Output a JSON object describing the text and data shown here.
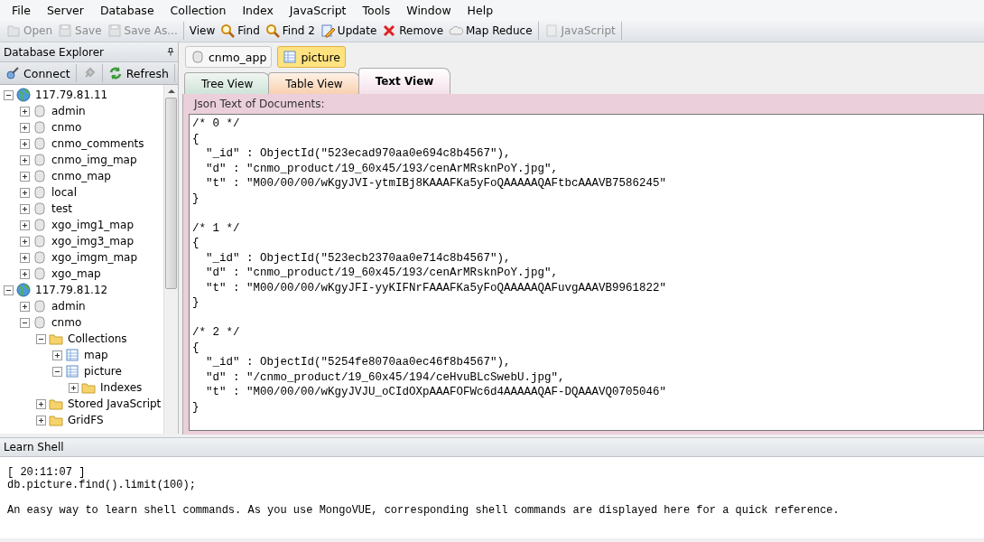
{
  "menu": [
    "File",
    "Server",
    "Database",
    "Collection",
    "Index",
    "JavaScript",
    "Tools",
    "Window",
    "Help"
  ],
  "toolbar": [
    [
      {
        "label": "Open",
        "disabled": true
      },
      {
        "label": "Save",
        "disabled": true
      },
      {
        "label": "Save As...",
        "disabled": true
      }
    ],
    [
      {
        "label": "View",
        "disabled": false
      },
      {
        "label": "Find",
        "disabled": false
      },
      {
        "label": "Find 2",
        "disabled": false
      },
      {
        "label": "Update",
        "disabled": false
      },
      {
        "label": "Remove",
        "disabled": false
      },
      {
        "label": "Map Reduce",
        "disabled": false
      }
    ],
    [
      {
        "label": "JavaScript",
        "disabled": true
      }
    ]
  ],
  "explorer": {
    "title": "Database Explorer",
    "buttons": [
      "Connect",
      "Refresh"
    ],
    "tree": [
      {
        "label": "117.79.81.11",
        "kind": "server",
        "expanded": true,
        "children": [
          {
            "label": "admin",
            "kind": "database",
            "expanded": false
          },
          {
            "label": "cnmo",
            "kind": "database",
            "expanded": false
          },
          {
            "label": "cnmo_comments",
            "kind": "database",
            "expanded": false
          },
          {
            "label": "cnmo_img_map",
            "kind": "database",
            "expanded": false
          },
          {
            "label": "cnmo_map",
            "kind": "database",
            "expanded": false
          },
          {
            "label": "local",
            "kind": "database",
            "expanded": false
          },
          {
            "label": "test",
            "kind": "database",
            "expanded": false
          },
          {
            "label": "xgo_img1_map",
            "kind": "database",
            "expanded": false
          },
          {
            "label": "xgo_img3_map",
            "kind": "database",
            "expanded": false
          },
          {
            "label": "xgo_imgm_map",
            "kind": "database",
            "expanded": false
          },
          {
            "label": "xgo_map",
            "kind": "database",
            "expanded": false
          }
        ]
      },
      {
        "label": "117.79.81.12",
        "kind": "server",
        "expanded": true,
        "children": [
          {
            "label": "admin",
            "kind": "database",
            "expanded": false
          },
          {
            "label": "cnmo",
            "kind": "database",
            "expanded": true,
            "children": [
              {
                "label": "Collections",
                "kind": "folder",
                "expanded": true,
                "children": [
                  {
                    "label": "map",
                    "kind": "collection",
                    "expanded": false
                  },
                  {
                    "label": "picture",
                    "kind": "collection",
                    "expanded": true,
                    "children": [
                      {
                        "label": "Indexes",
                        "kind": "folder",
                        "expanded": false
                      }
                    ]
                  }
                ]
              },
              {
                "label": "Stored JavaScript",
                "kind": "folder",
                "expanded": false
              },
              {
                "label": "GridFS",
                "kind": "folder",
                "expanded": false
              }
            ]
          }
        ]
      }
    ]
  },
  "doc_tabs": [
    {
      "label": "cnmo_app",
      "selected": false
    },
    {
      "label": "picture",
      "selected": true
    }
  ],
  "view_tabs": [
    {
      "label": "Tree View",
      "kind": "tree",
      "selected": false
    },
    {
      "label": "Table View",
      "kind": "table",
      "selected": false
    },
    {
      "label": "Text View",
      "kind": "text",
      "selected": true
    }
  ],
  "text_view": {
    "caption": "Json Text of Documents:",
    "documents": [
      {
        "header": "/* 0 */",
        "open": "{",
        "fields": [
          "\"_id\" : ObjectId(\"523ecad970aa0e694c8b4567\"),",
          "\"d\" : \"cnmo_product/19_60x45/193/cenArMRsknPoY.jpg\",",
          "\"t\" : \"M00/00/00/wKgyJVI-ytmIBj8KAAAFKa5yFoQAAAAAQAFtbcAAAVB7586245\""
        ],
        "close": "}"
      },
      {
        "header": "/* 1 */",
        "open": "{",
        "fields": [
          "\"_id\" : ObjectId(\"523ecb2370aa0e714c8b4567\"),",
          "\"d\" : \"cnmo_product/19_60x45/193/cenArMRsknPoY.jpg\",",
          "\"t\" : \"M00/00/00/wKgyJFI-yyKIFNrFAAAFKa5yFoQAAAAAQAFuvgAAAVB9961822\""
        ],
        "close": "}"
      },
      {
        "header": "/* 2 */",
        "open": "{",
        "fields": [
          "\"_id\" : ObjectId(\"5254fe8070aa0ec46f8b4567\"),",
          "\"d\" : \"/cnmo_product/19_60x45/194/ceHvuBLcSwebU.jpg\",",
          "\"t\" : \"M00/00/00/wKgyJVJU_oCIdOXpAAAFOFWc6d4AAAAAQAF-DQAAAVQ0705046\""
        ],
        "close": "}"
      }
    ]
  },
  "learn_shell": {
    "title": "Learn Shell",
    "lines": [
      "[ 20:11:07 ]",
      "db.picture.find().limit(100);"
    ],
    "note": "An easy way to learn shell commands. As you use MongoVUE, corresponding shell commands are displayed here for a quick reference."
  }
}
